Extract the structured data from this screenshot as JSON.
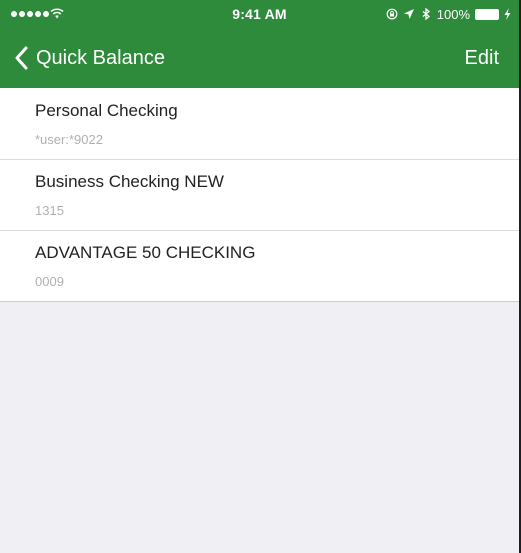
{
  "status_bar": {
    "time": "9:41 AM",
    "battery": "100%",
    "signal_icon": "signal-dots-icon",
    "wifi_icon": "wifi-icon",
    "lock_icon": "rotation-lock-icon",
    "location_icon": "location-arrow-icon",
    "bluetooth_icon": "bluetooth-icon",
    "battery_icon": "battery-icon",
    "charging_icon": "charging-bolt-icon"
  },
  "nav": {
    "back_label": "Quick Balance",
    "back_icon": "chevron-left-icon",
    "edit_label": "Edit"
  },
  "accounts": [
    {
      "name": "Personal Checking",
      "number": "*user:*9022"
    },
    {
      "name": "Business Checking NEW",
      "number": "1315"
    },
    {
      "name": "ADVANTAGE 50 CHECKING",
      "number": "0009"
    }
  ],
  "colors": {
    "header": "#2e8b3c",
    "header_text": "#ffffff",
    "background": "#efeff4",
    "row_background": "#ffffff",
    "secondary_text": "#b0b0b0"
  }
}
